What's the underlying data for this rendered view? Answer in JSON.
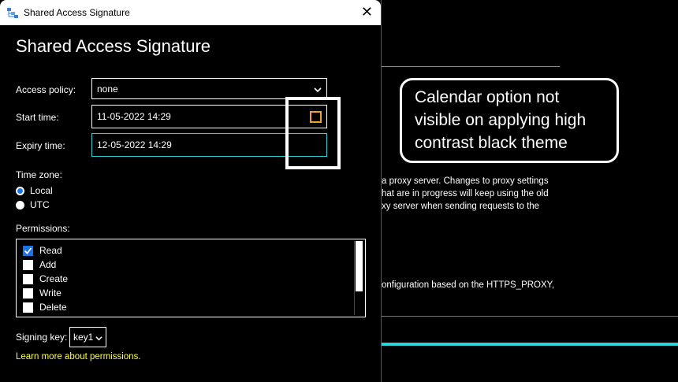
{
  "window": {
    "title": "Shared Access Signature",
    "close_glyph": "✕"
  },
  "dialog": {
    "heading": "Shared Access Signature",
    "access_policy": {
      "label": "Access policy:",
      "value": "none"
    },
    "start_time": {
      "label": "Start time:",
      "value": "11-05-2022  14:29"
    },
    "expiry_time": {
      "label": "Expiry time:",
      "value": "12-05-2022  14:29"
    },
    "time_zone": {
      "label": "Time zone:",
      "options": [
        {
          "label": "Local",
          "selected": true
        },
        {
          "label": "UTC",
          "selected": false
        }
      ]
    },
    "permissions": {
      "label": "Permissions:",
      "items": [
        {
          "label": "Read",
          "checked": true
        },
        {
          "label": "Add",
          "checked": false
        },
        {
          "label": "Create",
          "checked": false
        },
        {
          "label": "Write",
          "checked": false
        },
        {
          "label": "Delete",
          "checked": false
        }
      ]
    },
    "signing_key": {
      "label": "Signing key:",
      "value": "key1"
    },
    "learn_more_link": "Learn more about permissions."
  },
  "background": {
    "lines": [
      "a proxy server. Changes to proxy settings",
      "hat are in progress will keep using the old",
      "xy server when sending requests to the",
      "onfiguration based on the HTTPS_PROXY,"
    ]
  },
  "callout": {
    "text": "Calendar option not visible on applying high contrast black theme"
  },
  "colors": {
    "accent_cyan": "#2ad4d9",
    "link_yellow": "#ffff33",
    "calendar_orange": "#f0a030",
    "check_blue": "#1a73e8"
  }
}
